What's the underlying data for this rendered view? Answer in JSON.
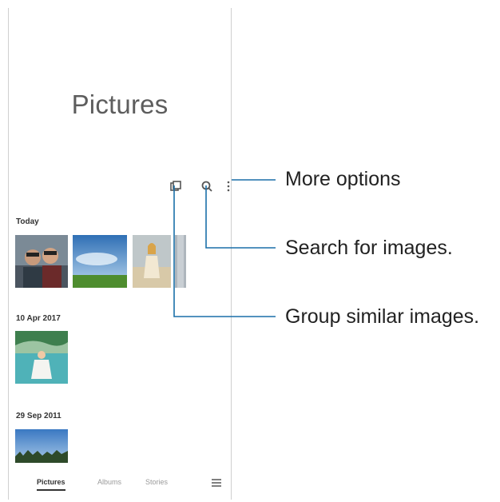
{
  "app": {
    "title": "Pictures"
  },
  "toolbar": {
    "group_icon": "group-similar-icon",
    "search_icon": "search-icon",
    "more_icon": "more-options-icon"
  },
  "sections": [
    {
      "date": "Today"
    },
    {
      "date": "10 Apr 2017"
    },
    {
      "date": "29 Sep 2011"
    }
  ],
  "nav": {
    "tabs": [
      "Pictures",
      "Albums",
      "Stories"
    ],
    "active": "Pictures",
    "menu_icon": "menu-icon"
  },
  "callouts": {
    "more": "More options",
    "search": "Search for images.",
    "group": "Group similar images."
  },
  "colors": {
    "callout_line": "#1a6fa8"
  }
}
